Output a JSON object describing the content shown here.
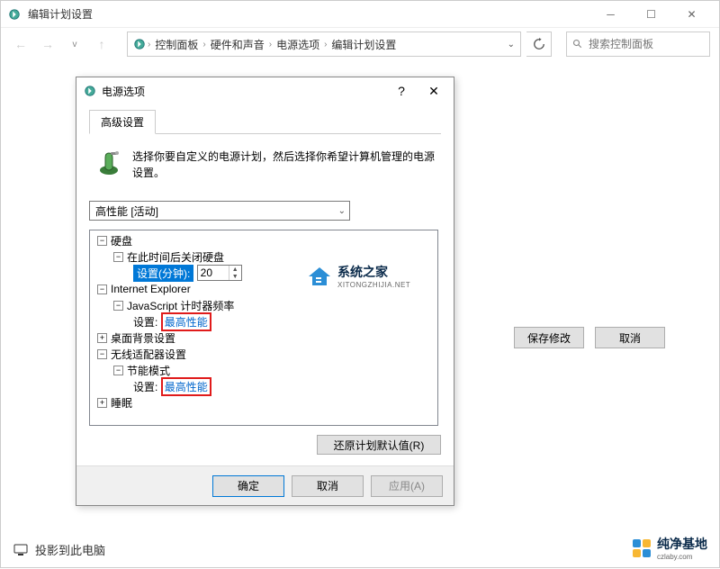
{
  "window": {
    "title": "编辑计划设置",
    "breadcrumbs": [
      "控制面板",
      "硬件和声音",
      "电源选项",
      "编辑计划设置"
    ],
    "search_placeholder": "搜索控制面板"
  },
  "right_buttons": {
    "save": "保存修改",
    "cancel": "取消"
  },
  "bottom_link": "投影到此电脑",
  "dialog": {
    "title": "电源选项",
    "tab": "高级设置",
    "description": "选择你要自定义的电源计划，然后选择你希望计算机管理的电源设置。",
    "plan": "高性能 [活动]",
    "tree": {
      "hdd": {
        "label": "硬盘",
        "sub": "在此时间后关闭硬盘",
        "setting_label": "设置(分钟):",
        "value": "20"
      },
      "ie": {
        "label": "Internet Explorer",
        "js": "JavaScript 计时器频率",
        "setting_label": "设置:",
        "value": "最高性能"
      },
      "desktop": "桌面背景设置",
      "wireless": {
        "label": "无线适配器设置",
        "sub": "节能模式",
        "setting_label": "设置:",
        "value": "最高性能"
      },
      "sleep": "睡眠"
    },
    "restore": "还原计划默认值(R)",
    "ok": "确定",
    "cancel": "取消",
    "apply": "应用(A)"
  },
  "watermarks": {
    "w1_text": "系统之家",
    "w1_sub": "XITONGZHIJIA.NET",
    "w2_text": "纯净基地",
    "w2_sub": "czlaby.com"
  }
}
